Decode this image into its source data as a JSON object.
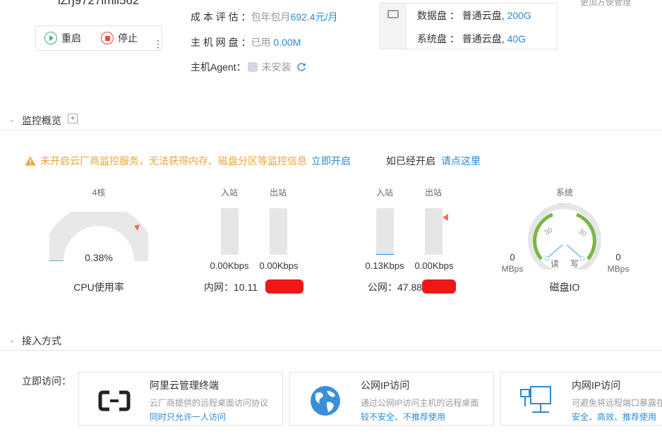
{
  "instance": {
    "partial_id": "iZrj9727imli562",
    "top_right_link": "更加方便管理"
  },
  "actions": {
    "restart_label": "重启",
    "stop_label": "停止",
    "more_glyph": "⋮"
  },
  "info": {
    "cost_label": "成 本 评 估 ：",
    "cost_prefix": "包年包月",
    "cost_value": "692.4元/月",
    "network_label": "主 机 网 盘 ：",
    "network_prefix": "已用",
    "network_value": "0.00M",
    "agent_label": "主机Agent：",
    "agent_value": "未安装"
  },
  "disks": [
    {
      "label": "数据盘 ：",
      "type": "普通云盘,",
      "size": "200G"
    },
    {
      "label": "系统盘 ：",
      "type": "普通云盘,",
      "size": "40G"
    }
  ],
  "monitor": {
    "section_title": "监控概览",
    "alert_text": "未开启云厂商监控服务，无法获得内存、磁盘分区等监控信息",
    "alert_link": "立即开启",
    "enabled_text": "如已经开启",
    "enabled_link": "请点这里",
    "cpu": {
      "cores": "4核",
      "percent_label": "0.38%",
      "percent": 0.38,
      "title": "CPU使用率"
    },
    "intranet": {
      "in_label": "入站",
      "out_label": "出站",
      "in_value": "0.00Kbps",
      "out_value": "0.00Kbps",
      "in_fill": 0,
      "out_fill": 0,
      "title": "内网：10.11"
    },
    "public": {
      "in_label": "入站",
      "out_label": "出站",
      "in_value": "0.13Kbps",
      "out_value": "0.00Kbps",
      "in_fill": 0.02,
      "out_fill": 0,
      "title": "公网：47.88"
    },
    "disk_io": {
      "system_label": "系统",
      "left_value": "0",
      "left_unit": "MBps",
      "right_value": "0",
      "right_unit": "MBps",
      "scale_left": "30",
      "scale_right": "30",
      "read_label": "读",
      "write_label": "写",
      "title": "磁盘IO"
    }
  },
  "access": {
    "section_title": "接入方式",
    "label": "立即访问：",
    "cards": [
      {
        "title": "阿里云管理终端",
        "desc": "云厂商提供的远程桌面访问协议",
        "note": "同时只允许一人访问",
        "icon": "aliyun-terminal-icon"
      },
      {
        "title": "公网IP访问",
        "desc": "通过公网IP访问主机的远程桌面",
        "note": "较不安全、不推荐使用",
        "icon": "globe-icon"
      },
      {
        "title": "内网IP访问",
        "desc": "可避免将远程端口暴露在",
        "note": "安全、高效、推荐使用",
        "icon": "network-icon"
      }
    ]
  },
  "colors": {
    "accent": "#2b8ad6",
    "warning": "#f0a23b",
    "success": "#3cb371",
    "danger": "#e74c3c"
  }
}
